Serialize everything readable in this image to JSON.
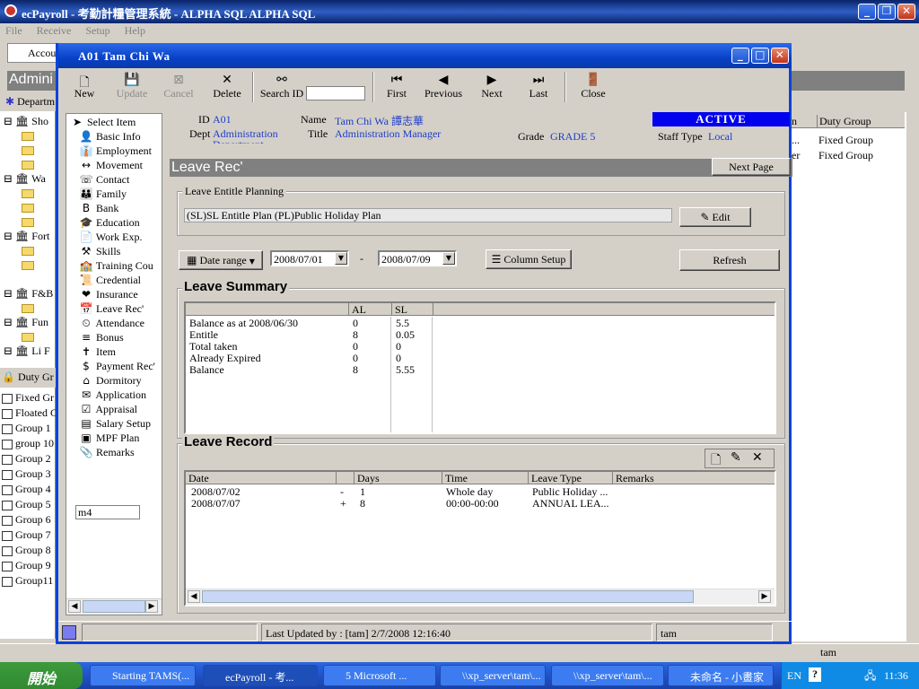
{
  "app": {
    "title": "ecPayroll - 考勤計糧管理系統 - ALPHA SQL ALPHA SQL",
    "menu": [
      "File",
      "Receive",
      "Setup",
      "Help"
    ],
    "acct": "Accou",
    "admin": "Admini",
    "dept": "Departm",
    "tree": [
      "Sho",
      "Wa",
      "Fort",
      "F&B",
      "Fun",
      "Li F"
    ],
    "duty_label": "Duty Gr",
    "groups": [
      "Fixed Gr",
      "Floated C",
      "Group 1",
      "group 10",
      "Group 2",
      "Group 3",
      "Group 4",
      "Group 5",
      "Group 6",
      "Group 7",
      "Group 8",
      "Group 9",
      "Group11"
    ],
    "right_col": {
      "h1": "n",
      "h2": "Duty Group",
      "rows": [
        {
          "a": "...",
          "b": "Fixed Group"
        },
        {
          "a": "er",
          "b": "Fixed Group"
        }
      ]
    },
    "status_right": "tam"
  },
  "dialog": {
    "title": "A01 Tam Chi Wa",
    "toolbar": {
      "new": "New",
      "update": "Update",
      "cancel": "Cancel",
      "delete": "Delete",
      "search_id": "Search ID",
      "first": "First",
      "previous": "Previous",
      "next": "Next",
      "last": "Last",
      "close": "Close"
    },
    "sidebar": {
      "header": "Select Item",
      "items": [
        "Basic Info",
        "Employment",
        "Movement",
        "Contact",
        "Family",
        "Bank",
        "Education",
        "Work Exp.",
        "Skills",
        "Training Cou",
        "Credential",
        "Insurance",
        "Leave Rec'",
        "Attendance",
        "Bonus",
        "Item",
        "Payment Rec'",
        "Dormitory",
        "Application",
        "Appraisal",
        "Salary Setup",
        "MPF Plan",
        "Remarks"
      ],
      "input": "m4"
    },
    "info": {
      "id_label": "ID",
      "id": "A01",
      "dept_label": "Dept",
      "dept": "Administration",
      "dept2": "Department",
      "name_label": "Name",
      "name": "Tam Chi Wa  譚志華",
      "title_label": "Title",
      "title": "Administration Manager",
      "grade_label": "Grade",
      "grade": "GRADE 5",
      "status": "ACTIVE",
      "staff_label": "Staff Type",
      "staff": "Local"
    },
    "section": "Leave Rec'",
    "next_page": "Next Page",
    "entitle": {
      "label": "Leave Entitle Planning",
      "value": "(SL)SL Entitle Plan (PL)Public Holiday Plan",
      "edit": "Edit"
    },
    "date_range": "Date range",
    "date_from": "2008/07/01",
    "date_dash": "-",
    "date_to": "2008/07/09",
    "column_setup": "Column Setup",
    "refresh": "Refresh",
    "summary": {
      "title": "Leave Summary",
      "cols": [
        "AL",
        "SL"
      ],
      "rows": [
        {
          "l": "Balance as at 2008/06/30",
          "al": "0",
          "sl": "5.5"
        },
        {
          "l": "Entitle",
          "al": "8",
          "sl": "0.05"
        },
        {
          "l": "Total taken",
          "al": "0",
          "sl": "0"
        },
        {
          "l": "Already Expired",
          "al": "0",
          "sl": "0"
        },
        {
          "l": "Balance",
          "al": "8",
          "sl": "5.55"
        }
      ]
    },
    "record": {
      "title": "Leave Record",
      "cols": [
        "Date",
        "",
        "Days",
        "Time",
        "Leave Type",
        "Remarks"
      ],
      "rows": [
        {
          "date": "2008/07/02",
          "s": "-",
          "days": "1",
          "time": "Whole day",
          "type": "Public Holiday ..."
        },
        {
          "date": "2008/07/07",
          "s": "+",
          "days": "8",
          "time": "00:00-00:00",
          "type": "ANNUAL LEA..."
        }
      ]
    },
    "status": {
      "updated": "Last Updated by : [tam]  2/7/2008 12:16:40",
      "user": "tam"
    }
  },
  "taskbar": {
    "start": "開始",
    "tasks": [
      "Starting TAMS(...",
      "ecPayroll - 考...",
      "5 Microsoft ...",
      "\\\\xp_server\\tam\\...",
      "\\\\xp_server\\tam\\...",
      "未命名 - 小畫家"
    ],
    "lang": "EN",
    "time": "11:36"
  }
}
